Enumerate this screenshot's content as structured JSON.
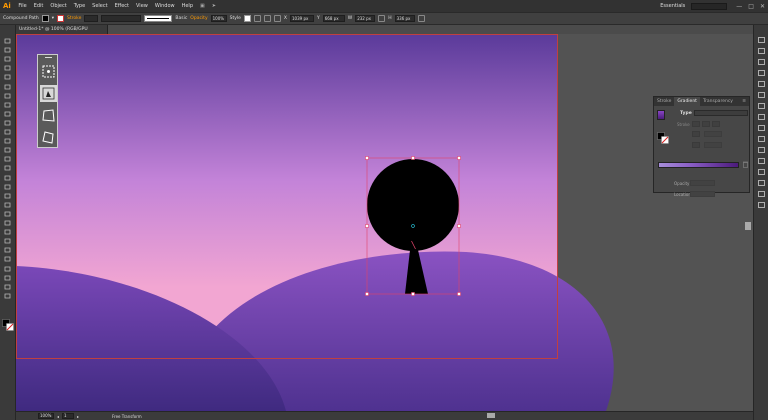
{
  "app": {
    "logo": "Ai",
    "menu": [
      "File",
      "Edit",
      "Object",
      "Type",
      "Select",
      "Effect",
      "View",
      "Window",
      "Help"
    ],
    "workspace": "Essentials",
    "window_controls": [
      "—",
      "□",
      "✕"
    ]
  },
  "controlbar": {
    "selection_type": "Compound Path",
    "stroke_label": "Stroke",
    "stroke_style": "Basic",
    "opacity_label": "Opacity",
    "opacity_value": "100%",
    "style_label": "Style",
    "x_label": "X",
    "x_value": "1039 px",
    "y_label": "Y",
    "y_value": "668 px",
    "w_label": "W",
    "w_value": "232 px",
    "h_label": "H",
    "h_value": "336 px"
  },
  "document": {
    "tab_title": "Untitled-1* @ 100% (RGB/GPU Preview)"
  },
  "gradient_panel": {
    "tabs": [
      "Stroke",
      "Gradient",
      "Transparency"
    ],
    "active_tab": "Gradient",
    "type_label": "Type",
    "stroke_label": "Stroke",
    "opacity_label": "Opacity",
    "location_label": "Location"
  },
  "statusbar": {
    "zoom": "100%",
    "page": "1",
    "status_text": "Free Transform"
  },
  "colors": {
    "accent_orange": "#ff9a00",
    "sky_top": "#5a3a9a",
    "sky_bottom": "#f0a8d6",
    "hill": "#7a48b8",
    "artboard_border": "#c04040",
    "selection_red": "#e0446a"
  },
  "icons": {
    "widget": [
      "free-distort-icon",
      "puppet-warp-icon",
      "perspective-distort-icon",
      "free-distort-corner-icon"
    ]
  }
}
